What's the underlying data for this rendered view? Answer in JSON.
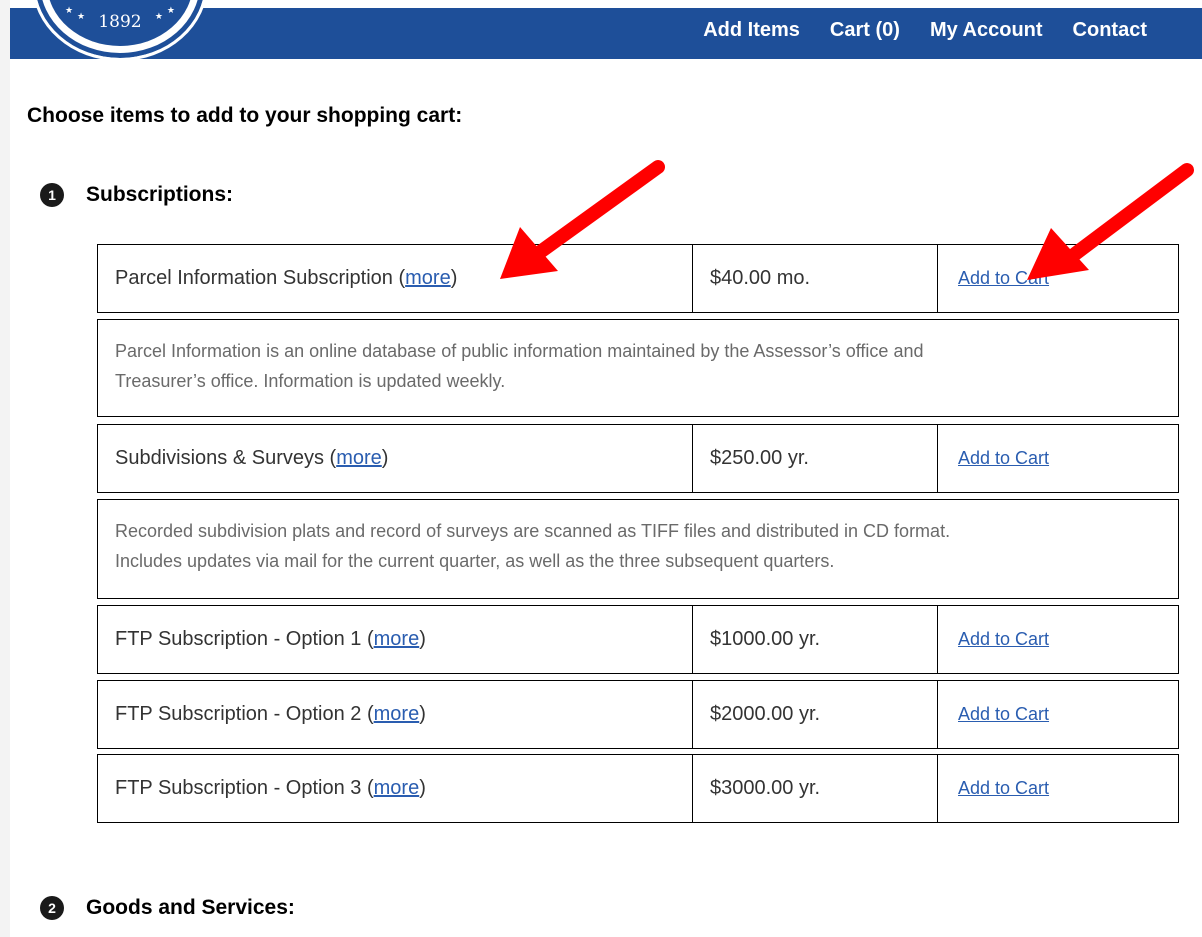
{
  "header": {
    "seal_year": "1892",
    "nav": [
      "Add Items",
      "Cart (0)",
      "My Account",
      "Contact"
    ]
  },
  "page_heading": "Choose items to add to your shopping cart:",
  "sections": [
    {
      "number": "1",
      "title": "Subscriptions:"
    },
    {
      "number": "2",
      "title": "Goods and Services:"
    }
  ],
  "items": [
    {
      "name": "Parcel Information Subscription",
      "more_label": "more",
      "price": "$40.00 mo.",
      "action": "Add to Cart",
      "description": [
        "Parcel Information is an online database of public information maintained by the Assessor’s office and",
        "Treasurer’s office. Information is updated weekly."
      ]
    },
    {
      "name": "Subdivisions & Surveys",
      "more_label": "more",
      "price": "$250.00 yr.",
      "action": "Add to Cart",
      "description": [
        "Recorded subdivision plats and record of surveys are scanned as TIFF files and distributed in CD format.",
        "Includes updates via mail for the current quarter, as well as the three subsequent quarters."
      ]
    },
    {
      "name": "FTP Subscription - Option 1",
      "more_label": "more",
      "price": "$1000.00 yr.",
      "action": "Add to Cart"
    },
    {
      "name": "FTP Subscription - Option 2",
      "more_label": "more",
      "price": "$2000.00 yr.",
      "action": "Add to Cart"
    },
    {
      "name": "FTP Subscription - Option 3",
      "more_label": "more",
      "price": "$3000.00 yr.",
      "action": "Add to Cart"
    }
  ],
  "colors": {
    "brand_blue": "#1e4f99",
    "link": "#2a5db0",
    "arrow": "#ff0000"
  },
  "annotations": [
    "red-arrow-pointing-to-more-link",
    "red-arrow-pointing-to-add-to-cart"
  ]
}
